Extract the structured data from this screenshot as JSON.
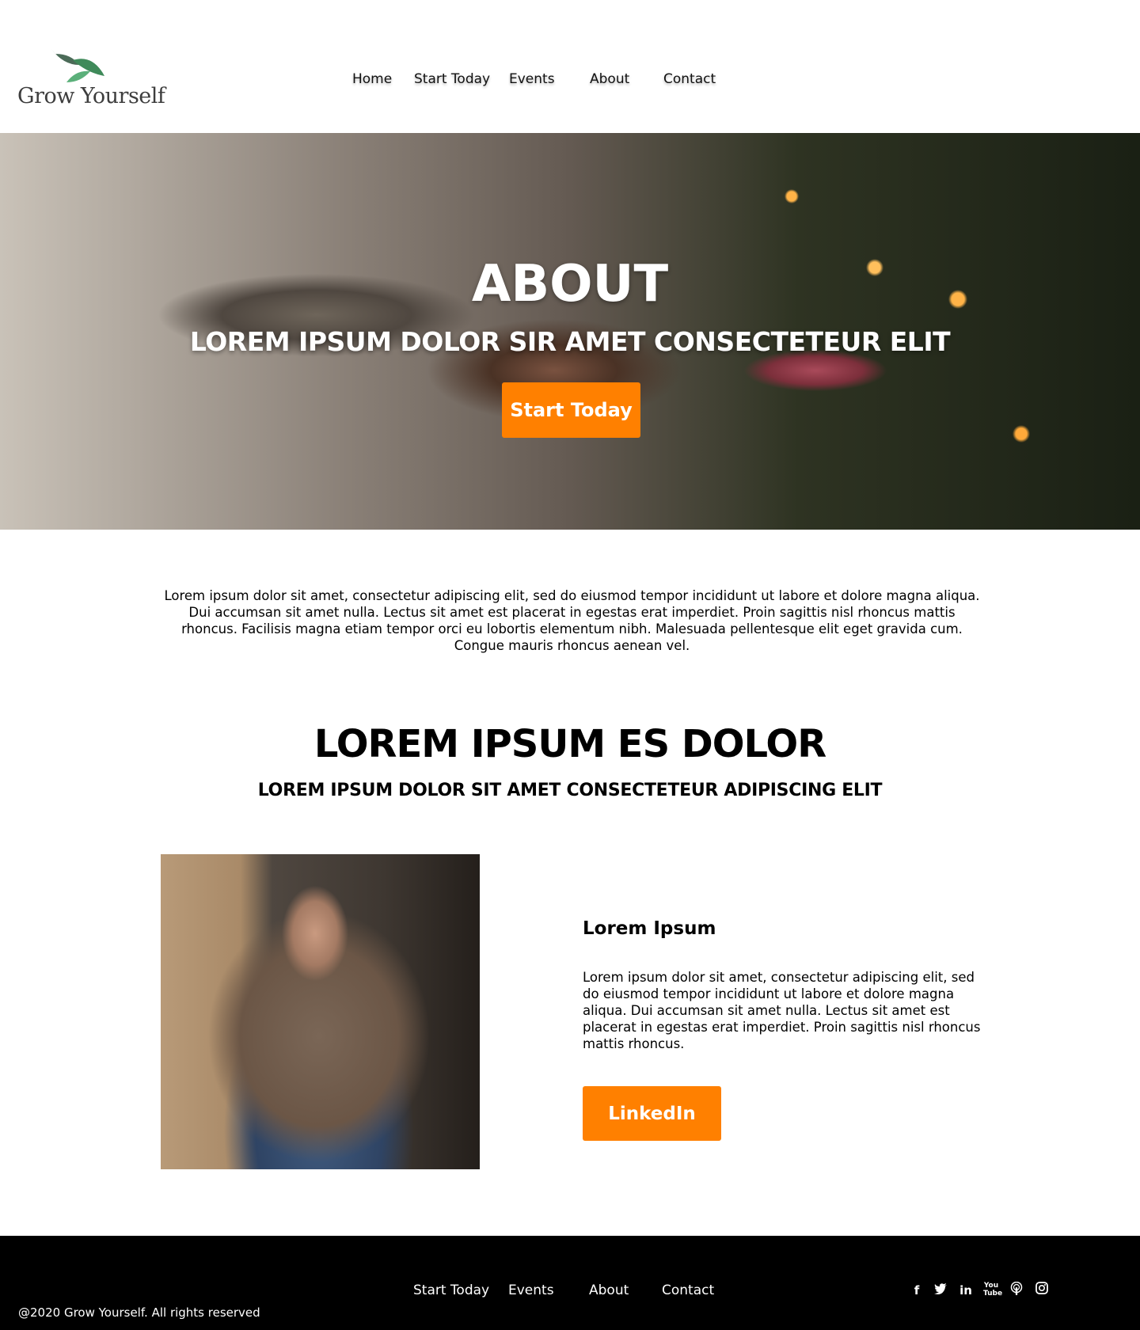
{
  "header": {
    "logo_text": "Grow Yourself",
    "nav": [
      "Home",
      "Start Today",
      "Events",
      "About",
      "Contact"
    ]
  },
  "hero": {
    "title": "ABOUT",
    "subtitle": "LOREM IPSUM DOLOR SIR AMET CONSECTETEUR ELIT",
    "cta_label": "Start Today"
  },
  "intro": {
    "text": "Lorem ipsum dolor sit amet, consectetur adipiscing elit, sed do eiusmod tempor incididunt ut labore et dolore magna aliqua. Dui accumsan sit amet nulla. Lectus sit amet est placerat in egestas erat imperdiet. Proin sagittis nisl rhoncus mattis rhoncus. Facilisis magna etiam tempor orci eu lobortis elementum nibh. Malesuada pellentesque elit eget gravida cum. Congue mauris rhoncus aenean vel."
  },
  "section": {
    "heading": "LOREM IPSUM ES DOLOR",
    "subheading": "LOREM IPSUM DOLOR SIT AMET CONSECTETEUR ADIPISCING ELIT",
    "card": {
      "title": "Lorem Ipsum",
      "text": "Lorem ipsum dolor sit amet, consectetur adipiscing elit, sed do eiusmod tempor incididunt ut labore et dolore magna aliqua. Dui accumsan sit amet nulla. Lectus sit amet est placerat in egestas erat imperdiet. Proin sagittis nisl rhoncus mattis rhoncus.",
      "button_label": "LinkedIn"
    }
  },
  "footer": {
    "nav": [
      "Start Today",
      "Events",
      "About",
      "Contact"
    ],
    "copyright": "@2020 Grow Yourself. All rights reserved",
    "social_icons": [
      "facebook-icon",
      "twitter-icon",
      "linkedin-icon",
      "youtube-icon",
      "podcast-icon",
      "instagram-icon"
    ]
  },
  "colors": {
    "accent": "#ff8000",
    "footer_bg": "#000000",
    "logo_green": "#3f8a5a"
  }
}
